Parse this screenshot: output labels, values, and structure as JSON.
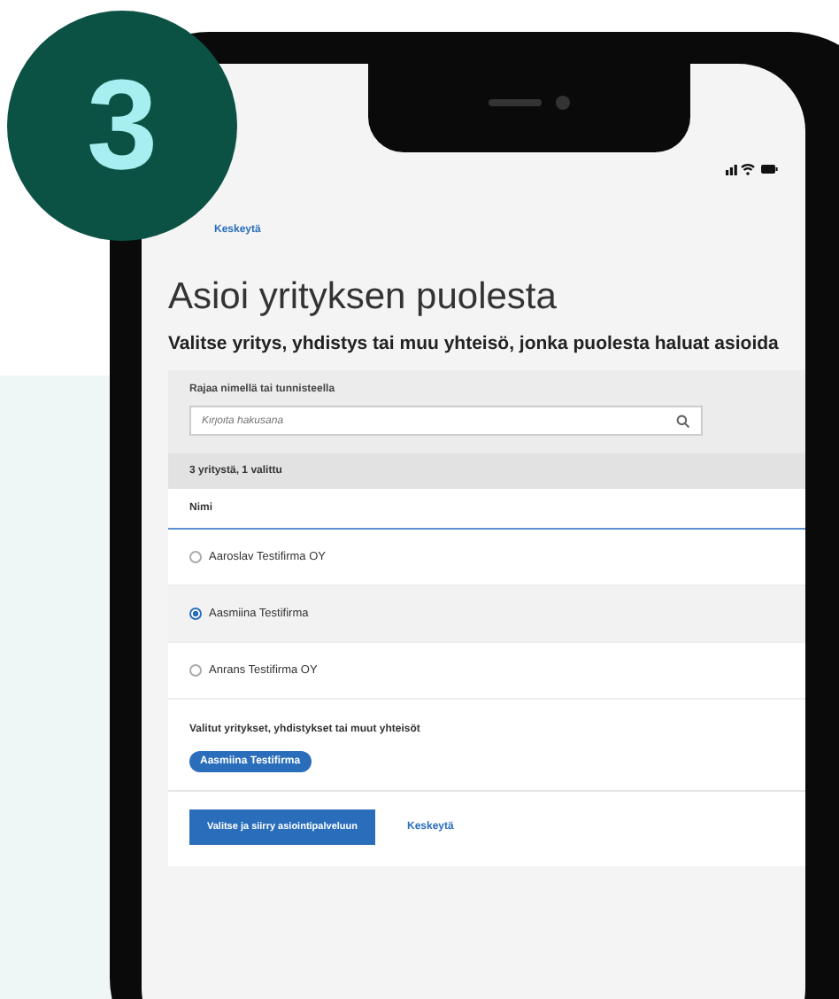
{
  "badge": {
    "number": "3"
  },
  "screen": {
    "top_link": "Keskeytä",
    "title": "Asioi yrityksen puolesta",
    "subtitle": "Valitse yritys, yhdistys tai muu yhteisö, jonka puolesta haluat asioida",
    "filter": {
      "label": "Rajaa nimellä tai tunnisteella",
      "placeholder": "Kirjoita hakusana"
    },
    "count": "3 yritystä, 1 valittu",
    "column": "Nimi",
    "rows": [
      {
        "name": "Aaroslav Testifirma OY",
        "selected": false
      },
      {
        "name": "Aasmiina Testifirma",
        "selected": true
      },
      {
        "name": "Anrans Testifirma OY",
        "selected": false
      }
    ],
    "selected_heading": "Valitut yritykset, yhdistykset tai muut yhteisöt",
    "chips": [
      "Aasmiina Testifirma"
    ],
    "primary_button": "Valitse ja siirry asiointipalveluun",
    "cancel_link": "Keskeytä"
  }
}
